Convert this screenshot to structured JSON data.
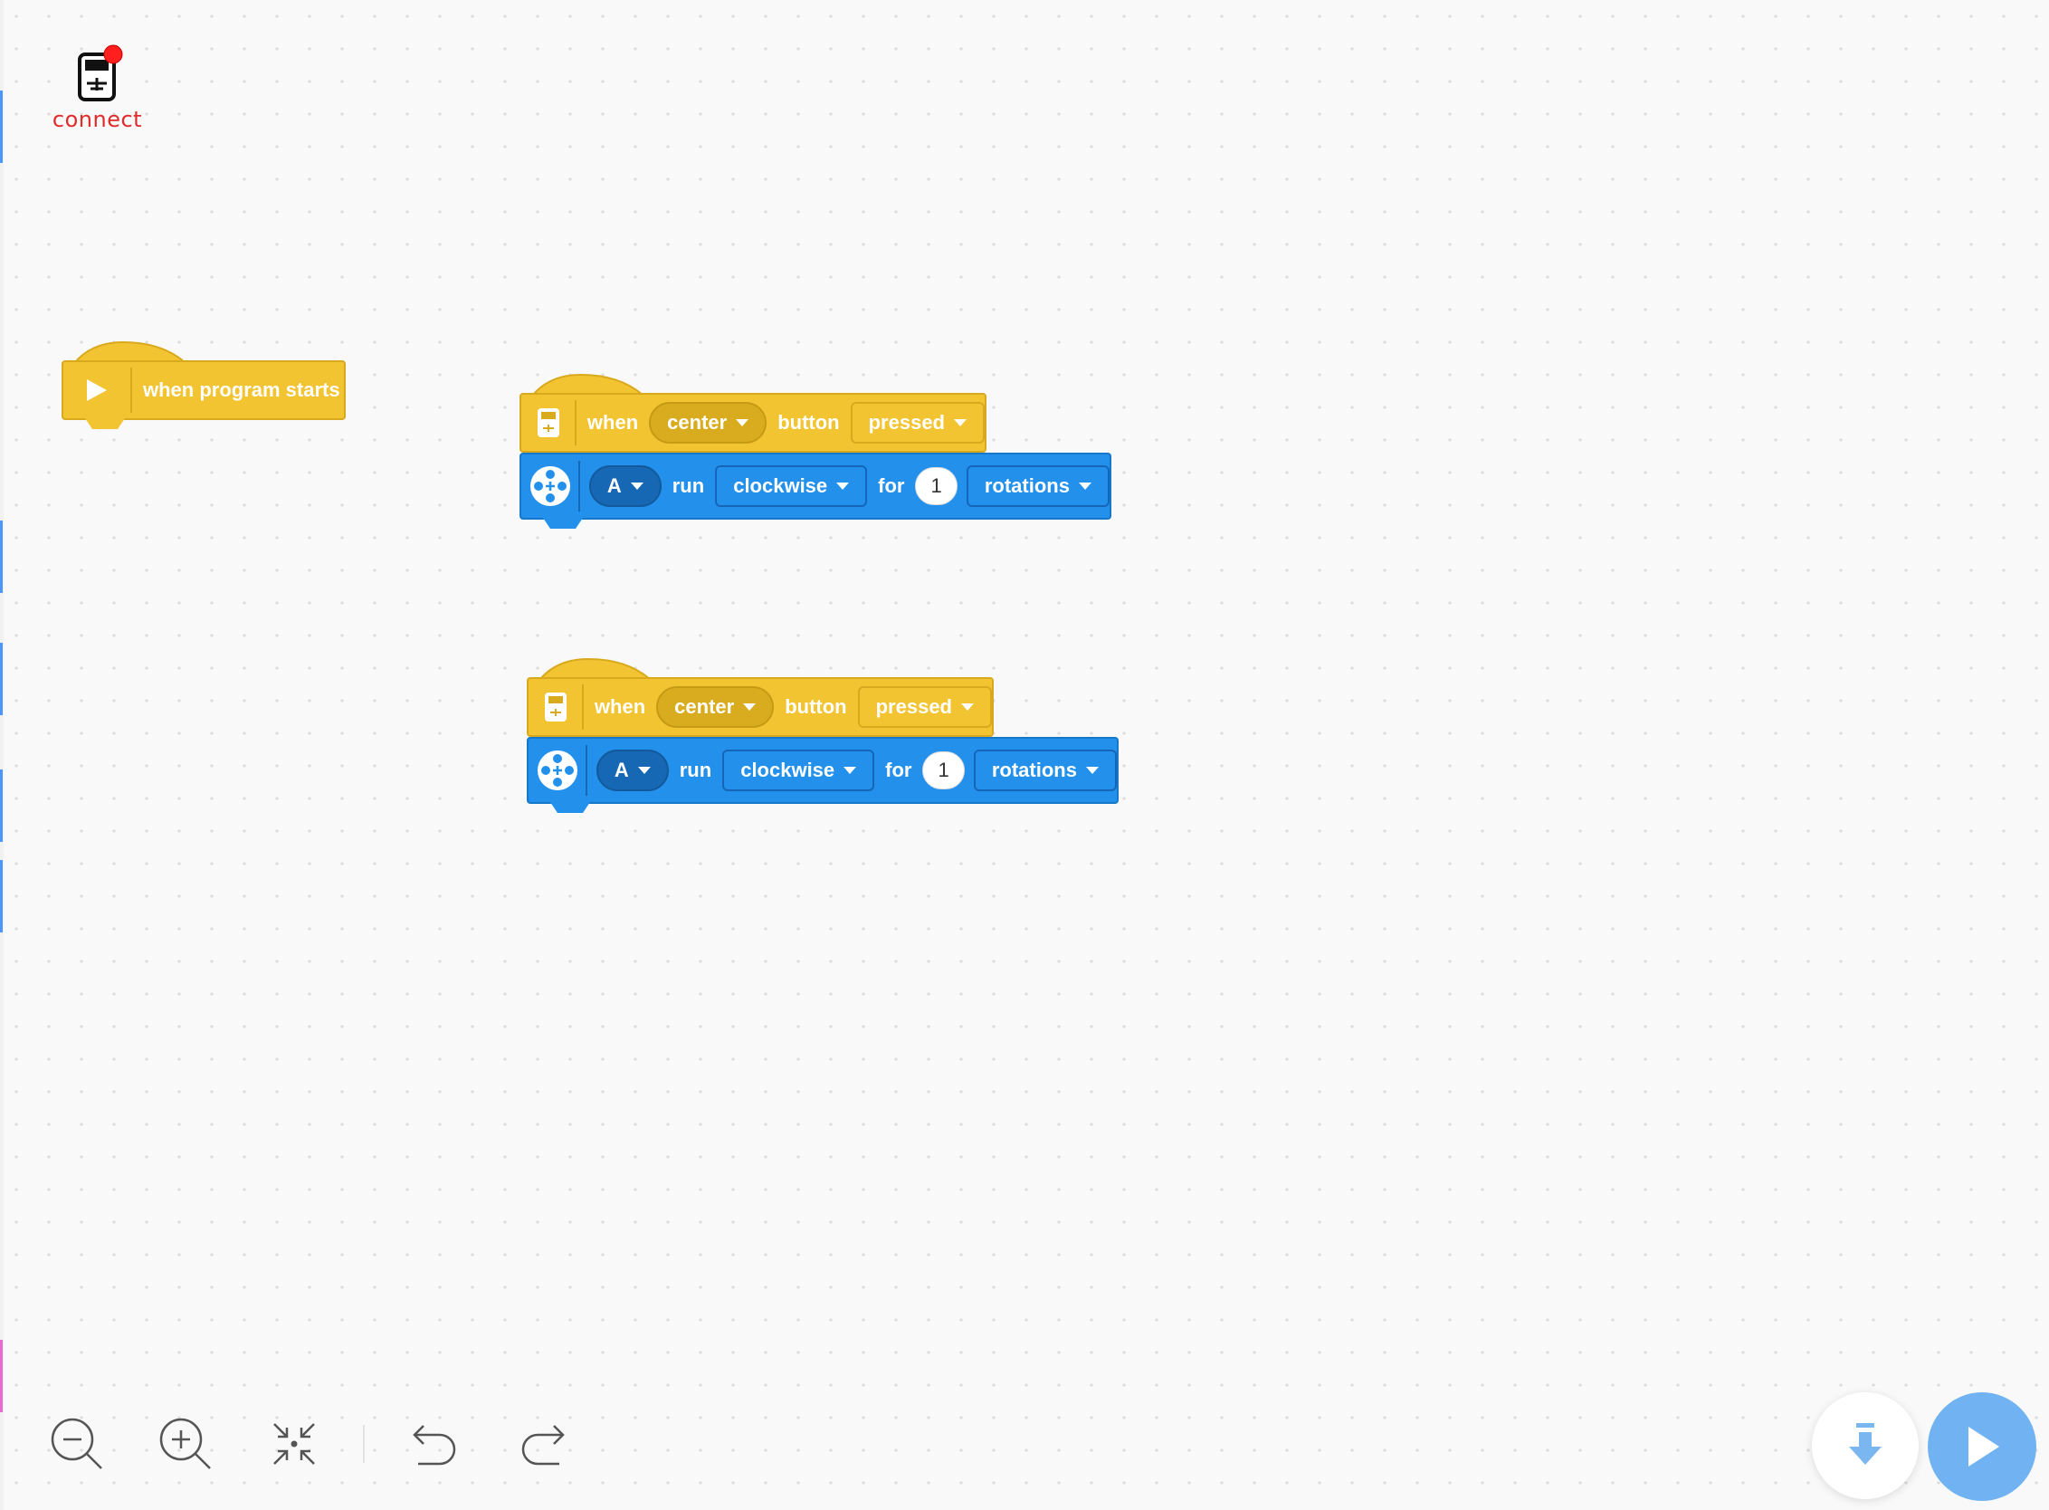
{
  "connect": {
    "label": "connect",
    "icon": "hub-icon",
    "status_color": "#e02b2b"
  },
  "blocks": {
    "start": {
      "label": "when program starts"
    },
    "stack1": {
      "when": "when",
      "button_choice": "center",
      "button_word": "button",
      "event": "pressed",
      "port": "A",
      "run": "run",
      "direction": "clockwise",
      "for": "for",
      "amount": "1",
      "unit": "rotations"
    },
    "stack2": {
      "when": "when",
      "button_choice": "center",
      "button_word": "button",
      "event": "pressed",
      "port": "A",
      "run": "run",
      "direction": "clockwise",
      "for": "for",
      "amount": "1",
      "unit": "rotations"
    }
  },
  "colors": {
    "event_block": "#f2c431",
    "motor_block": "#2391ec",
    "play_button": "#71b3f2",
    "download_arrow": "#7ab6f0"
  },
  "toolbar": {
    "icons": [
      "zoom-out-icon",
      "zoom-in-icon",
      "recenter-icon",
      "undo-icon",
      "redo-icon"
    ]
  },
  "actions": {
    "download_icon": "download-icon",
    "play_icon": "play-icon"
  }
}
